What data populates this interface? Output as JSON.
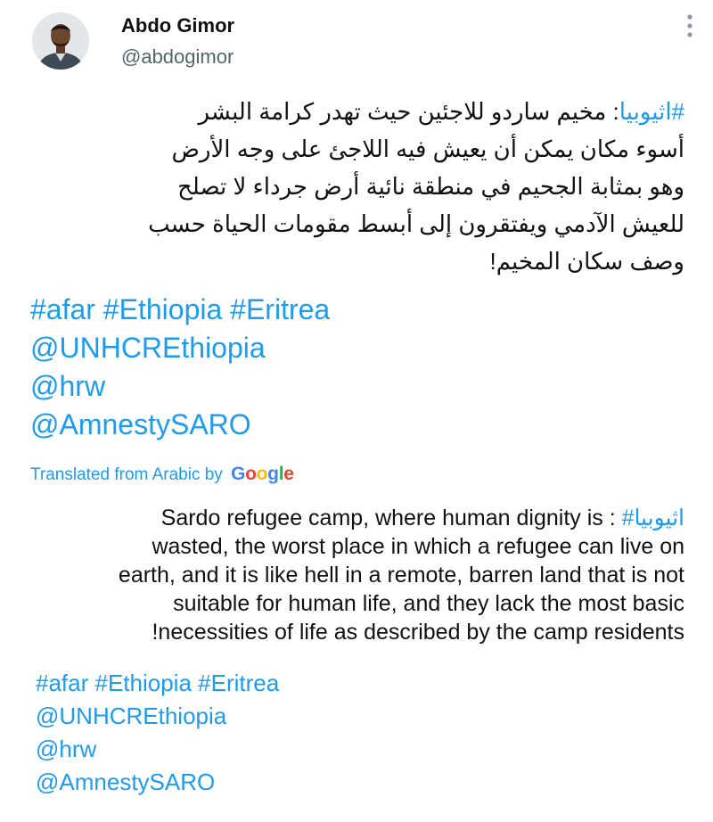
{
  "tweet": {
    "author_name": "Abdo Gimor",
    "author_handle": "@abdogimor",
    "arabic": {
      "line1_tag": "#اثيوبيا",
      "line1_text": ": مخيم ساردو للاجئين  حيث تهدر كرامة البشر",
      "line2": "أسوء مكان يمكن أن يعيش فيه اللاجئ على وجه الأرض",
      "line3": "وهو بمثابة الجحيم في منطقة نائية أرض جرداء  لا تصلح",
      "line4": "للعيش الآدمي ويفتقرون إلى أبسط مقومات الحياة حسب",
      "line5": "وصف سكان المخيم!"
    },
    "tags": {
      "afar": "#afar",
      "ethiopia": "#Ethiopia",
      "eritrea": "#Eritrea",
      "unhcr": "@UNHCREthiopia",
      "hrw": "@hrw",
      "amnesty": "@AmnestySARO"
    }
  },
  "translation": {
    "label": "Translated from Arabic by",
    "google_logo": "Google",
    "line1_text": "Sardo refugee camp, where human dignity is : ",
    "line1_tag": "#اثيوبيا",
    "line2": "wasted, the worst place in which a refugee can live on",
    "line3": "earth, and it is like hell in a remote, barren land that is not",
    "line4": "suitable for human life, and they lack the most basic",
    "line5": "!necessities of life as described by the camp residents",
    "tags": {
      "afar": "#afar",
      "ethiopia": "#Ethiopia",
      "eritrea": "#Eritrea",
      "unhcr": "@UNHCREthiopia",
      "hrw": "@hrw",
      "amnesty": "@AmnestySARO"
    }
  },
  "colors": {
    "link": "#1d9bf0",
    "text": "#111111",
    "secondary": "#536471"
  },
  "icons": {
    "avatar": "profile-photo",
    "menu": "vertical-dots-icon"
  }
}
